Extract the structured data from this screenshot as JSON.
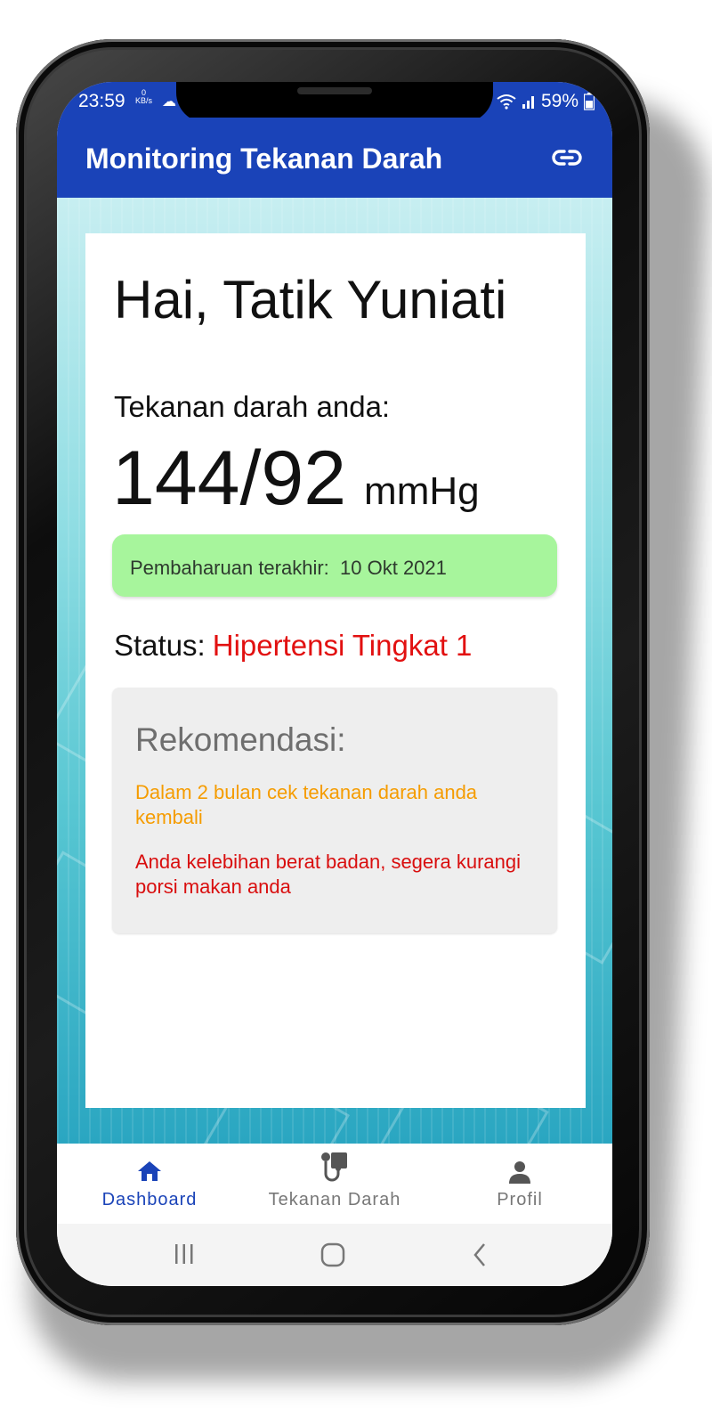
{
  "status_bar": {
    "time": "23:59",
    "speed_value": "0",
    "speed_unit": "KB/s",
    "battery": "59%"
  },
  "app_bar": {
    "title": "Monitoring Tekanan Darah",
    "action_icon": "link-icon"
  },
  "dashboard": {
    "greeting": "Hai, Tatik Yuniati",
    "bp_label": "Tekanan darah anda:",
    "bp_value": "144/92",
    "bp_unit": "mmHg",
    "last_update_label": "Pembaharuan terakhir:",
    "last_update_date": "10 Okt 2021",
    "status_label": "Status:",
    "status_value": "Hipertensi Tingkat 1",
    "recommendation_title": "Rekomendasi:",
    "recommendations": [
      {
        "text": "Dalam 2 bulan cek tekanan darah anda kembali",
        "color": "#f59c00"
      },
      {
        "text": "Anda kelebihan berat badan, segera kurangi porsi makan anda",
        "color": "#d90e0e"
      }
    ]
  },
  "bottom_nav": [
    {
      "label": "Dashboard",
      "icon": "home-icon",
      "active": true
    },
    {
      "label": "Tekanan Darah",
      "icon": "stethoscope-icon",
      "active": false
    },
    {
      "label": "Profil",
      "icon": "person-icon",
      "active": false
    }
  ],
  "colors": {
    "primary": "#1a43b8",
    "update_box": "#a7f59c",
    "status_danger": "#e21010",
    "recommendation_box": "#eeeeee"
  }
}
